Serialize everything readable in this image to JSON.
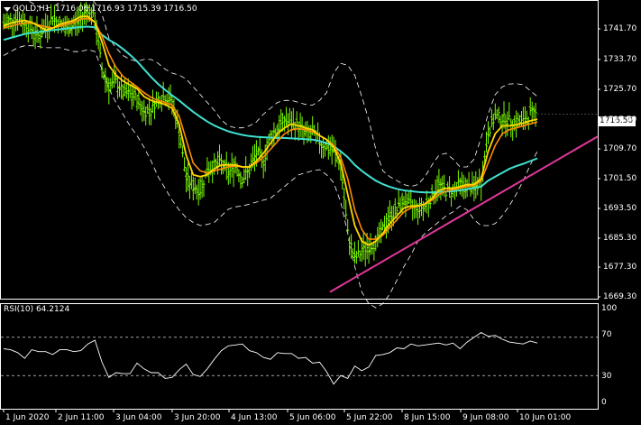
{
  "header": {
    "symbol": "GOLD,H1",
    "ohlc": "1716.06 1716.93 1715.39 1716.50"
  },
  "price_axis": {
    "ticks": [
      "1741.70",
      "1733.70",
      "1725.70",
      "1717.70",
      "1709.70",
      "1701.50",
      "1693.50",
      "1685.30",
      "1677.30",
      "1669.30"
    ],
    "current_price": "1716.50"
  },
  "rsi": {
    "label": "RSI(10) 64.2124",
    "ticks": [
      "100",
      "70",
      "30",
      "0"
    ]
  },
  "time_axis": {
    "ticks": [
      "1 Jun 2020",
      "2 Jun 11:00",
      "3 Jun 04:00",
      "3 Jun 20:00",
      "4 Jun 13:00",
      "5 Jun 06:00",
      "5 Jun 22:00",
      "8 Jun 15:00",
      "9 Jun 08:00",
      "10 Jun 01:00"
    ]
  },
  "colors": {
    "background": "#000000",
    "candles": "#7CFC00",
    "fast_ma": "#FFD700",
    "mid_ma": "#FF8C00",
    "slow_ma": "#40E0D0",
    "trendline": "#E0389A",
    "bands": "#FFFFFF",
    "rsi_line": "#FFFFFF"
  },
  "chart_data": {
    "type": "line",
    "title": "GOLD,H1",
    "price": {
      "ylim": [
        1669.3,
        1745.7
      ],
      "close": [
        1739.5,
        1740.5,
        1741,
        1739.8,
        1738.2,
        1736.5,
        1738.8,
        1741.2,
        1739.5,
        1738.2,
        1739.5,
        1741,
        1743.5,
        1740.5,
        1728,
        1723.5,
        1724.8,
        1722,
        1721.5,
        1720.5,
        1717,
        1718,
        1720.5,
        1721,
        1719.8,
        1712,
        1700,
        1698,
        1697,
        1702,
        1703.5,
        1704,
        1701.5,
        1703.5,
        1700,
        1702,
        1706.5,
        1704.5,
        1711,
        1712.5,
        1715,
        1714,
        1713.5,
        1711.5,
        1711.6,
        1709.5,
        1708,
        1707.2,
        1703.5,
        1686,
        1679.5,
        1681.5,
        1682.8,
        1683.5,
        1687,
        1690.5,
        1692,
        1694.5,
        1693,
        1692.5,
        1693,
        1695.5,
        1698.5,
        1696.8,
        1697.2,
        1698.5,
        1697.8,
        1697.6,
        1699,
        1712,
        1716,
        1715.5,
        1714.8,
        1714.4,
        1714.5,
        1716.5,
        1716.5
      ],
      "fast_ma": [
        1739,
        1739.8,
        1740.2,
        1740.5,
        1740,
        1739,
        1738,
        1738.5,
        1739.5,
        1740,
        1740.5,
        1741.5,
        1741.5,
        1740,
        1735,
        1729,
        1726.5,
        1725,
        1724,
        1723,
        1721,
        1720,
        1719.5,
        1719,
        1718,
        1714,
        1706,
        1701,
        1700.5,
        1701,
        1702.5,
        1703.5,
        1703.5,
        1703.5,
        1703,
        1703,
        1704.5,
        1706.5,
        1709,
        1711.5,
        1713,
        1714,
        1713.5,
        1713,
        1712.5,
        1711,
        1710,
        1708,
        1704,
        1696,
        1688,
        1684,
        1683,
        1684,
        1686,
        1688.5,
        1690.5,
        1692.5,
        1693,
        1693,
        1693.5,
        1695,
        1697,
        1697.5,
        1697.5,
        1698,
        1698.5,
        1698.5,
        1700,
        1707,
        1711.5,
        1713.5,
        1713.5,
        1713.8,
        1714.2,
        1714.8,
        1715.2
      ],
      "mid_ma": [
        1738.5,
        1739,
        1739.5,
        1739.8,
        1739.8,
        1739.3,
        1738.8,
        1738.6,
        1739,
        1739.5,
        1740,
        1740.8,
        1741,
        1740,
        1736.5,
        1732,
        1728.5,
        1726.2,
        1724.8,
        1723.5,
        1722,
        1720.8,
        1720,
        1719.5,
        1718.8,
        1716,
        1710,
        1704,
        1702,
        1701.5,
        1702,
        1702.5,
        1703,
        1703.2,
        1703,
        1703,
        1704,
        1705.5,
        1707.5,
        1709.5,
        1711.5,
        1712.5,
        1712.8,
        1712.5,
        1712,
        1711,
        1710,
        1708.5,
        1705.5,
        1700,
        1692,
        1687,
        1684.5,
        1684.5,
        1685.5,
        1687.5,
        1689.5,
        1691.5,
        1692.5,
        1693,
        1693.5,
        1694.5,
        1696,
        1696.8,
        1697.2,
        1697.6,
        1698,
        1698.3,
        1699.5,
        1704,
        1708.5,
        1711.5,
        1712.5,
        1713,
        1713.5,
        1714,
        1714.5
      ],
      "slow_ma": [
        1735.5,
        1736,
        1736.5,
        1737,
        1737.3,
        1737.5,
        1737.8,
        1738,
        1738.2,
        1738.4,
        1738.6,
        1738.8,
        1738.9,
        1738.7,
        1736.8,
        1735.5,
        1734.5,
        1733.2,
        1731.7,
        1730,
        1728,
        1726,
        1724.2,
        1722.7,
        1721.3,
        1720,
        1718.5,
        1717.1,
        1715.8,
        1714.6,
        1713.6,
        1712.8,
        1712.1,
        1711.6,
        1711.2,
        1710.9,
        1710.7,
        1710.6,
        1710.5,
        1710.4,
        1710.4,
        1710.3,
        1710.2,
        1710.1,
        1710,
        1709.6,
        1709.1,
        1708.3,
        1707,
        1705.5,
        1703.5,
        1702,
        1700.7,
        1699.5,
        1698.6,
        1697.9,
        1697.4,
        1697,
        1696.8,
        1696.6,
        1696.5,
        1696.5,
        1696.6,
        1696.7,
        1696.8,
        1697,
        1697.3,
        1697.6,
        1698,
        1699.5,
        1700.5,
        1701.5,
        1702.5,
        1703.2,
        1703.8,
        1704.5,
        1705.2
      ],
      "bb_upper": [
        1745.5,
        1746,
        1746.5,
        1746,
        1745,
        1744,
        1743.5,
        1744,
        1745,
        1746,
        1747,
        1747.5,
        1747,
        1745,
        1742,
        1736,
        1733.5,
        1731.5,
        1730.5,
        1730,
        1730.5,
        1730.5,
        1729.5,
        1728,
        1727,
        1726.5,
        1725.5,
        1723.5,
        1721.5,
        1719.5,
        1717.5,
        1715,
        1713.5,
        1713,
        1713,
        1713.5,
        1714.5,
        1716.5,
        1718,
        1719.5,
        1720,
        1720,
        1719.5,
        1719,
        1718.8,
        1720,
        1722,
        1727,
        1729.5,
        1729,
        1726.5,
        1721,
        1715,
        1707.5,
        1702,
        1700.5,
        1699.5,
        1698.5,
        1698,
        1698.5,
        1700.5,
        1703.5,
        1706,
        1706.5,
        1705,
        1703,
        1703,
        1705,
        1710.5,
        1716.5,
        1721.5,
        1723.5,
        1724.2,
        1724.3,
        1724,
        1722.5,
        1721
      ],
      "bb_lower": [
        1731.5,
        1732.5,
        1733.5,
        1734,
        1734,
        1733.8,
        1733.5,
        1733.5,
        1733.5,
        1733,
        1732.5,
        1732.5,
        1733,
        1732.5,
        1728,
        1723,
        1719.5,
        1716.5,
        1713.5,
        1711,
        1708,
        1704.5,
        1700.5,
        1697.5,
        1694.5,
        1692,
        1690,
        1688.8,
        1688,
        1688.3,
        1688.8,
        1690.5,
        1692.2,
        1692.8,
        1693,
        1693.5,
        1694,
        1694.5,
        1695,
        1696.5,
        1698,
        1699.5,
        1701,
        1701.5,
        1702,
        1702.3,
        1701,
        1699,
        1694,
        1686,
        1677.5,
        1671,
        1668,
        1667,
        1668,
        1670.5,
        1674,
        1677.5,
        1680.5,
        1684,
        1686,
        1687.5,
        1689,
        1690.5,
        1691.5,
        1693,
        1692,
        1689.5,
        1688,
        1688,
        1688.5,
        1690.5,
        1693,
        1696,
        1699.5,
        1703.5,
        1707
      ]
    },
    "trendline": {
      "from": [
        "5 Jun 06:00",
        1671.0
      ],
      "to": [
        "10 Jun 05:00",
        1710.8
      ]
    },
    "rsi": {
      "ylim": [
        0,
        100
      ],
      "levels": [
        30,
        70
      ],
      "values": [
        58,
        57,
        54,
        48,
        57,
        55,
        55,
        52,
        57,
        57,
        55,
        56,
        63,
        67,
        44,
        28,
        33,
        32,
        32,
        43,
        37,
        33,
        33,
        27,
        28,
        36,
        42,
        31,
        29,
        37,
        47,
        56,
        61,
        62,
        63,
        56,
        54,
        49,
        47,
        54,
        53,
        53,
        48,
        49,
        43,
        44,
        34,
        21,
        30,
        27,
        40,
        35,
        39,
        51,
        52,
        54,
        59,
        58,
        63,
        61,
        62,
        63,
        64,
        62,
        64,
        58,
        65,
        70,
        75,
        71,
        72,
        68,
        65,
        64,
        63,
        66,
        64
      ]
    }
  }
}
